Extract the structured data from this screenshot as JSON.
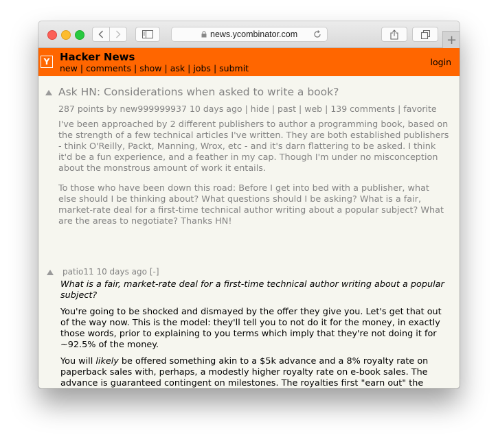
{
  "browser": {
    "url": "news.ycombinator.com",
    "new_tab_symbol": "+"
  },
  "header": {
    "logo_letter": "Y",
    "site_title": "Hacker News",
    "nav": [
      "new",
      "comments",
      "show",
      "ask",
      "jobs",
      "submit"
    ],
    "nav_separator": "|",
    "login": "login",
    "brand_color": "#ff6600"
  },
  "story": {
    "title": "Ask HN: Considerations when asked to write a book?",
    "points": "287 points",
    "by_label": "by",
    "author": "new999999937",
    "age": "10 days ago",
    "links": [
      "hide",
      "past",
      "web",
      "139 comments",
      "favorite"
    ],
    "separator": "|",
    "paragraphs": [
      "I've been approached by 2 different publishers to author a programming book, based on\nthe strength of a few technical articles I've written. They are both established publishers\n- think O'Reilly, Packt, Manning, Wrox, etc - and it's darn flattering to be asked. I think\nit'd be a fun experience, and a feather in my cap. Though I'm under no misconception\nabout the monstrous amount of work it entails.",
      "To those who have been down this road: Before I get into bed with a publisher, what\nelse should I be thinking about? What questions should I be asking? What is a fair,\nmarket-rate deal for a first-time technical author writing about a popular subject? What\nare the areas to negotiate? Thanks HN!"
    ]
  },
  "comment": {
    "author": "patio11",
    "age": "10 days ago",
    "toggle": "[-]",
    "quote": "What is a fair, market-rate deal for a first-time technical author writing about a popular\nsubject?",
    "paragraph1": "You're going to be shocked and dismayed by the offer they give you. Let's get that out\nof the way now. This is the model: they'll tell you to not do it for the money, in exactly\nthose words, prior to explaining to you terms which imply that they're not doing it for\n~92.5% of the money.",
    "paragraph2_prefix": "You will ",
    "paragraph2_emphasis": "likely",
    "paragraph2_rest": " be offered something akin to a $5k advance and a 8% royalty rate on\npaperback sales with, perhaps, a modestly higher royalty rate on e-book sales. The\nadvance is guaranteed contingent on milestones. The royalties first \"earn out\" the"
  }
}
